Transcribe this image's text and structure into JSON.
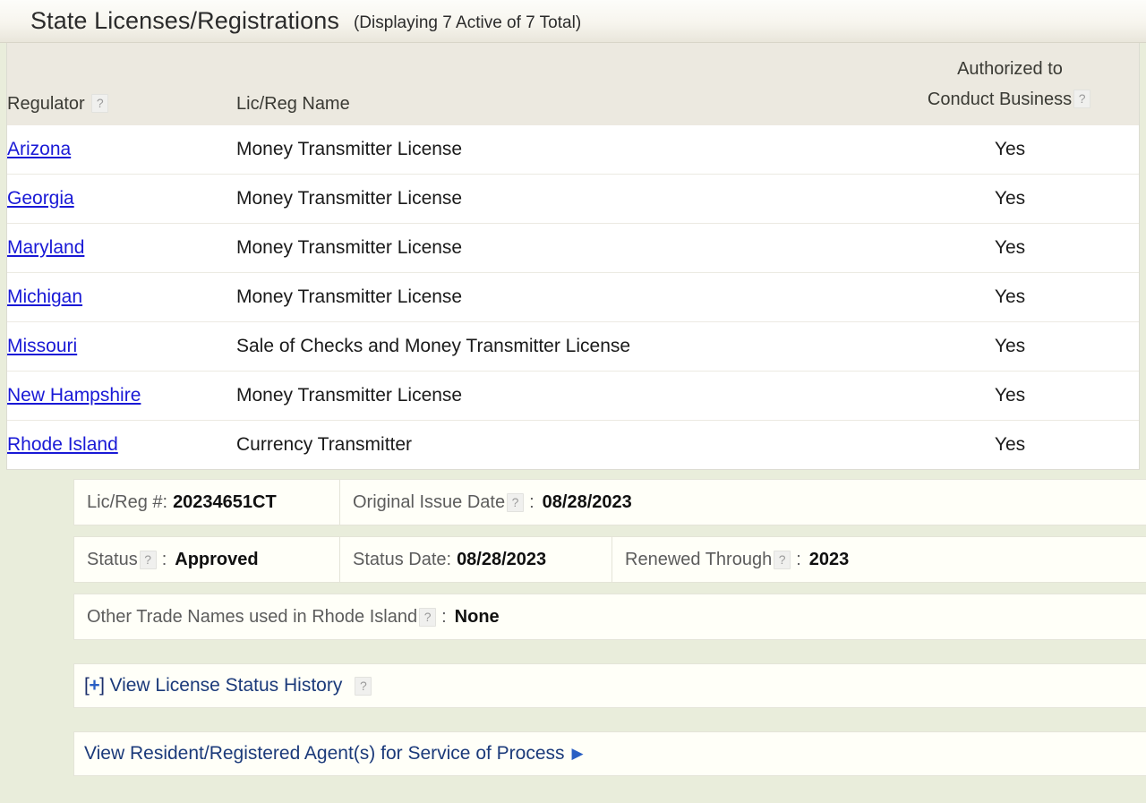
{
  "header": {
    "title": "State Licenses/Registrations",
    "count_text": "(Displaying 7 Active of 7 Total)"
  },
  "table": {
    "columns": {
      "regulator": "Regulator",
      "lic_reg_name": "Lic/Reg Name",
      "authorized_line1": "Authorized to",
      "authorized_line2": "Conduct Business"
    },
    "help_icon": "?",
    "rows": [
      {
        "regulator": "Arizona",
        "lic_reg_name": "Money Transmitter License",
        "authorized": "Yes"
      },
      {
        "regulator": "Georgia",
        "lic_reg_name": "Money Transmitter License",
        "authorized": "Yes"
      },
      {
        "regulator": "Maryland",
        "lic_reg_name": "Money Transmitter License",
        "authorized": "Yes"
      },
      {
        "regulator": "Michigan",
        "lic_reg_name": "Money Transmitter License",
        "authorized": "Yes"
      },
      {
        "regulator": "Missouri",
        "lic_reg_name": "Sale of Checks and Money Transmitter License",
        "authorized": "Yes"
      },
      {
        "regulator": "New Hampshire",
        "lic_reg_name": "Money Transmitter License",
        "authorized": "Yes"
      },
      {
        "regulator": "Rhode Island",
        "lic_reg_name": "Currency Transmitter",
        "authorized": "Yes"
      }
    ]
  },
  "detail": {
    "lic_reg_number_label": "Lic/Reg #:",
    "lic_reg_number_value": "20234651CT",
    "original_issue_date_label": "Original Issue Date",
    "original_issue_date_value": "08/28/2023",
    "status_label": "Status",
    "status_value": "Approved",
    "status_date_label": "Status Date:",
    "status_date_value": "08/28/2023",
    "renewed_through_label": "Renewed Through",
    "renewed_through_value": "2023",
    "other_trade_names_label": "Other Trade Names used in Rhode Island",
    "other_trade_names_value": "None",
    "colon": ":",
    "view_status_history": "View License Status History",
    "expander_open": "[",
    "expander_plus": "+",
    "expander_close": "]",
    "view_agents": "View Resident/Registered Agent(s) for Service of Process",
    "arrow_glyph": "▶"
  },
  "colors": {
    "page_background": "#e9eddb",
    "header_background": "#ece9e0",
    "row_background": "#ffffff",
    "detail_row_background": "#fffff8",
    "state_link": "#1919d6",
    "detail_link": "#1b3a7a"
  }
}
